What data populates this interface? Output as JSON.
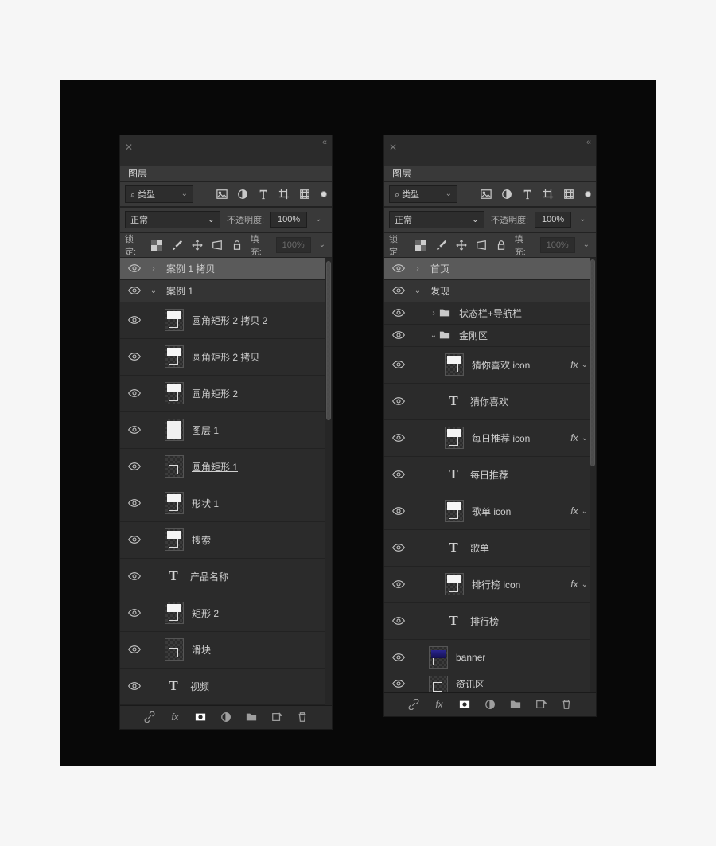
{
  "panel": {
    "tab_title": "图层",
    "filter_label": "类型",
    "blend_mode": "正常",
    "opacity_label": "不透明度:",
    "opacity_value": "100%",
    "lock_label": "锁定:",
    "fill_label": "填充:",
    "fill_value": "100%",
    "fx_label": "fx"
  },
  "left": {
    "layers": [
      {
        "name": "案例 1 拷贝",
        "type": "group",
        "arrow": ">",
        "selected": true,
        "height": "short"
      },
      {
        "name": "案例 1",
        "type": "group",
        "arrow": "v",
        "height": "short",
        "dim": true
      },
      {
        "name": "圆角矩形 2 拷贝 2",
        "type": "shape",
        "indent": 1,
        "thumb": "white-top"
      },
      {
        "name": "圆角矩形 2 拷贝",
        "type": "shape",
        "indent": 1,
        "thumb": "white-top"
      },
      {
        "name": "圆角矩形 2",
        "type": "shape",
        "indent": 1,
        "thumb": "white-top"
      },
      {
        "name": "图层 1",
        "type": "smart",
        "indent": 1,
        "thumb": "fullwhite"
      },
      {
        "name": "圆角矩形 1",
        "type": "shape",
        "indent": 1,
        "underline": true
      },
      {
        "name": "形状 1",
        "type": "shape",
        "indent": 1,
        "thumb": "white-top"
      },
      {
        "name": "搜索",
        "type": "shape",
        "indent": 1,
        "thumb": "white-top"
      },
      {
        "name": "产品名称",
        "type": "text",
        "indent": 1
      },
      {
        "name": "矩形 2",
        "type": "shape",
        "indent": 1,
        "thumb": "white-top"
      },
      {
        "name": "滑块",
        "type": "shape",
        "indent": 1
      },
      {
        "name": "视频",
        "type": "text",
        "indent": 1
      }
    ]
  },
  "right": {
    "layers": [
      {
        "name": "首页",
        "type": "group",
        "arrow": ">",
        "selected": true,
        "height": "short"
      },
      {
        "name": "发现",
        "type": "group",
        "arrow": "v",
        "height": "short",
        "dim": true
      },
      {
        "name": "状态栏+导航栏",
        "type": "folder",
        "arrow": ">",
        "indent": 1,
        "height": "short"
      },
      {
        "name": "金刚区",
        "type": "folder-open",
        "arrow": "v",
        "indent": 1,
        "height": "short"
      },
      {
        "name": "猜你喜欢 icon",
        "type": "shape",
        "indent": 2,
        "thumb": "white-top",
        "fx": true
      },
      {
        "name": "猜你喜欢",
        "type": "text",
        "indent": 2
      },
      {
        "name": "每日推荐 icon",
        "type": "shape",
        "indent": 2,
        "thumb": "white-top",
        "fx": true
      },
      {
        "name": "每日推荐",
        "type": "text",
        "indent": 2
      },
      {
        "name": "歌单 icon",
        "type": "shape",
        "indent": 2,
        "thumb": "white-top",
        "fx": true
      },
      {
        "name": "歌单",
        "type": "text",
        "indent": 2
      },
      {
        "name": "排行榜 icon",
        "type": "shape",
        "indent": 2,
        "thumb": "white-top",
        "fx": true
      },
      {
        "name": "排行榜",
        "type": "text",
        "indent": 2
      },
      {
        "name": "banner",
        "type": "shape",
        "indent": 1,
        "thumb": "banner"
      },
      {
        "name": "资讯区",
        "type": "shape",
        "indent": 1,
        "cut": true
      }
    ]
  }
}
